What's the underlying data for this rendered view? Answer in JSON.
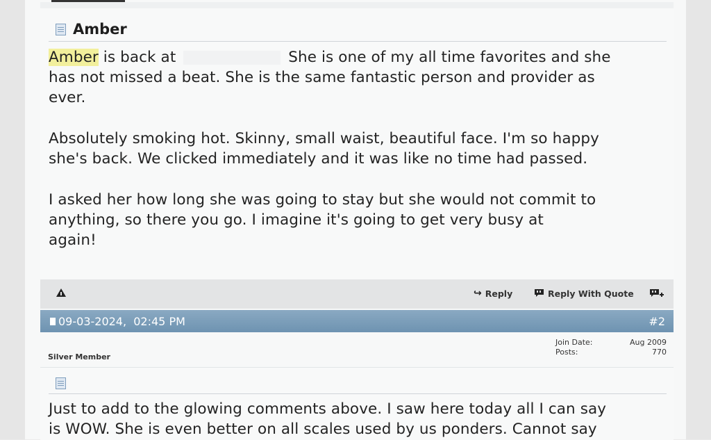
{
  "post1": {
    "title": "Amber",
    "para1": {
      "name": "Amber",
      "rest1": " is back at ",
      "rest2": " She is one of my all time favorites and she",
      "line2": "has not missed a beat. She is the same fantastic person and provider as",
      "line3": "ever."
    },
    "para2": {
      "line1": "Absolutely smoking hot. Skinny, small waist, beautiful face. I'm so happy",
      "line2": "she's back. We clicked immediately and it was like no time had passed."
    },
    "para3": {
      "line1": "I asked her how long she was going to stay but she would not commit to",
      "line2": "anything, so there you go. I imagine it's going to get very busy at",
      "line3": "again!"
    }
  },
  "footer": {
    "reply": "Reply",
    "reply_with_quote": "Reply With Quote",
    "reply_icon": "↪",
    "quote_icon": "quote-bubble-icon",
    "multiquote_icon": "multiquote-plus-icon",
    "report_icon": "warning-icon"
  },
  "post2": {
    "date": "09-03-2024,",
    "time": "02:45 PM",
    "number": "#2",
    "member_title": "Silver Member",
    "join_label": "Join Date:",
    "join_value": "Aug 2009",
    "posts_label": "Posts:",
    "posts_value": "770",
    "line1": "Just to add to the glowing comments above. I saw here today all I can say",
    "line2": "is WOW. She is even better on all scales used by us ponders. Cannot say"
  },
  "colors": {
    "header_blue": "#7a9bb7",
    "highlight": "#f2ef9c"
  }
}
